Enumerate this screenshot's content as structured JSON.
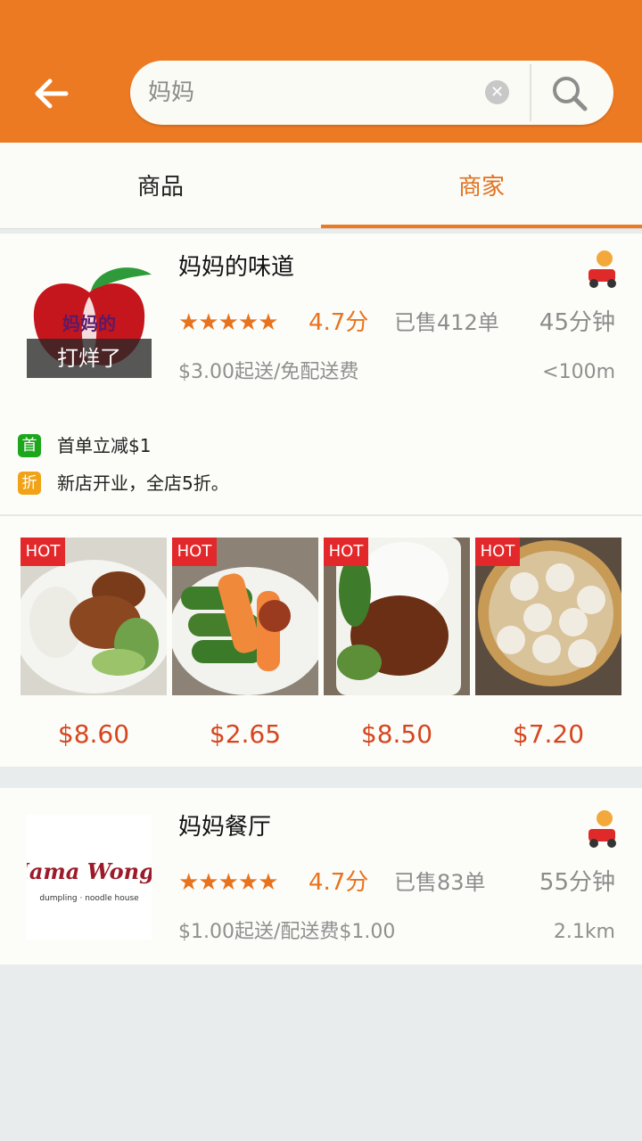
{
  "search": {
    "query": "妈妈"
  },
  "tabs": [
    {
      "label": "商品"
    },
    {
      "label": "商家"
    }
  ],
  "shops": [
    {
      "name": "妈妈的味道",
      "logo_caption": "打烊了",
      "logo_brand_text": "妈妈的",
      "stars": "★★★★★",
      "rating": "4.7分",
      "sold": "已售412单",
      "delivery_time": "45分钟",
      "fee": "$3.00起送/免配送费",
      "distance": "<100m",
      "promos": [
        {
          "badge": "首",
          "color": "#1da61c",
          "text": "首单立减$1"
        },
        {
          "badge": "折",
          "color": "#f0a317",
          "text": "新店开业，全店5折。"
        }
      ],
      "dishes": [
        {
          "tag": "HOT",
          "price": "$8.60"
        },
        {
          "tag": "HOT",
          "price": "$2.65"
        },
        {
          "tag": "HOT",
          "price": "$8.50"
        },
        {
          "tag": "HOT",
          "price": "$7.20"
        }
      ]
    },
    {
      "name": "妈妈餐厅",
      "logo_brand_text": "Mama Wong's",
      "logo_sub_text": "dumpling · noodle house",
      "stars": "★★★★★",
      "rating": "4.7分",
      "sold": "已售83单",
      "delivery_time": "55分钟",
      "fee": "$1.00起送/配送费$1.00",
      "distance": "2.1km"
    }
  ],
  "colors": {
    "brand": "#ec7a22",
    "accent_text": "#e2711f",
    "price": "#d6461e",
    "hot": "#e3282b"
  },
  "icons": {
    "back": "arrow-left-icon",
    "search": "search-icon",
    "clear": "clear-icon",
    "rider": "delivery-rider-icon"
  }
}
